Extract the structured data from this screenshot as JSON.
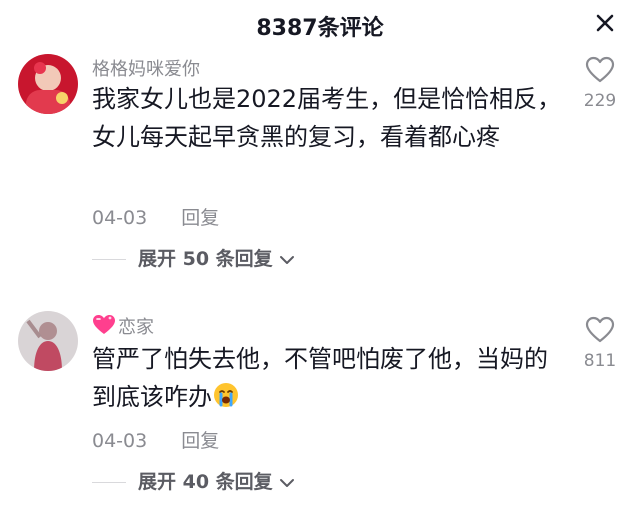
{
  "header": {
    "title": "8387条评论",
    "close_icon": "close-icon"
  },
  "comments": [
    {
      "username": "格格妈咪爱你",
      "text": "我家女儿也是2022届考生，但是恰恰相反，女儿每天起早贪黑的复习，看着都心疼",
      "date": "04-03",
      "reply_label": "回复",
      "likes": "229",
      "expand_label": "展开 50 条回复"
    },
    {
      "username": "恋家",
      "badge_icon": "heart-badge-icon",
      "text": "管严了怕失去他，不管吧怕废了他，当妈的到底该咋办",
      "emoji_icon": "crying-face-icon",
      "date": "04-03",
      "reply_label": "回复",
      "likes": "811",
      "expand_label": "展开 40 条回复"
    }
  ],
  "colors": {
    "primary_text": "#161823",
    "secondary_text": "#8a8b91",
    "divider": "#d9d9dc"
  }
}
